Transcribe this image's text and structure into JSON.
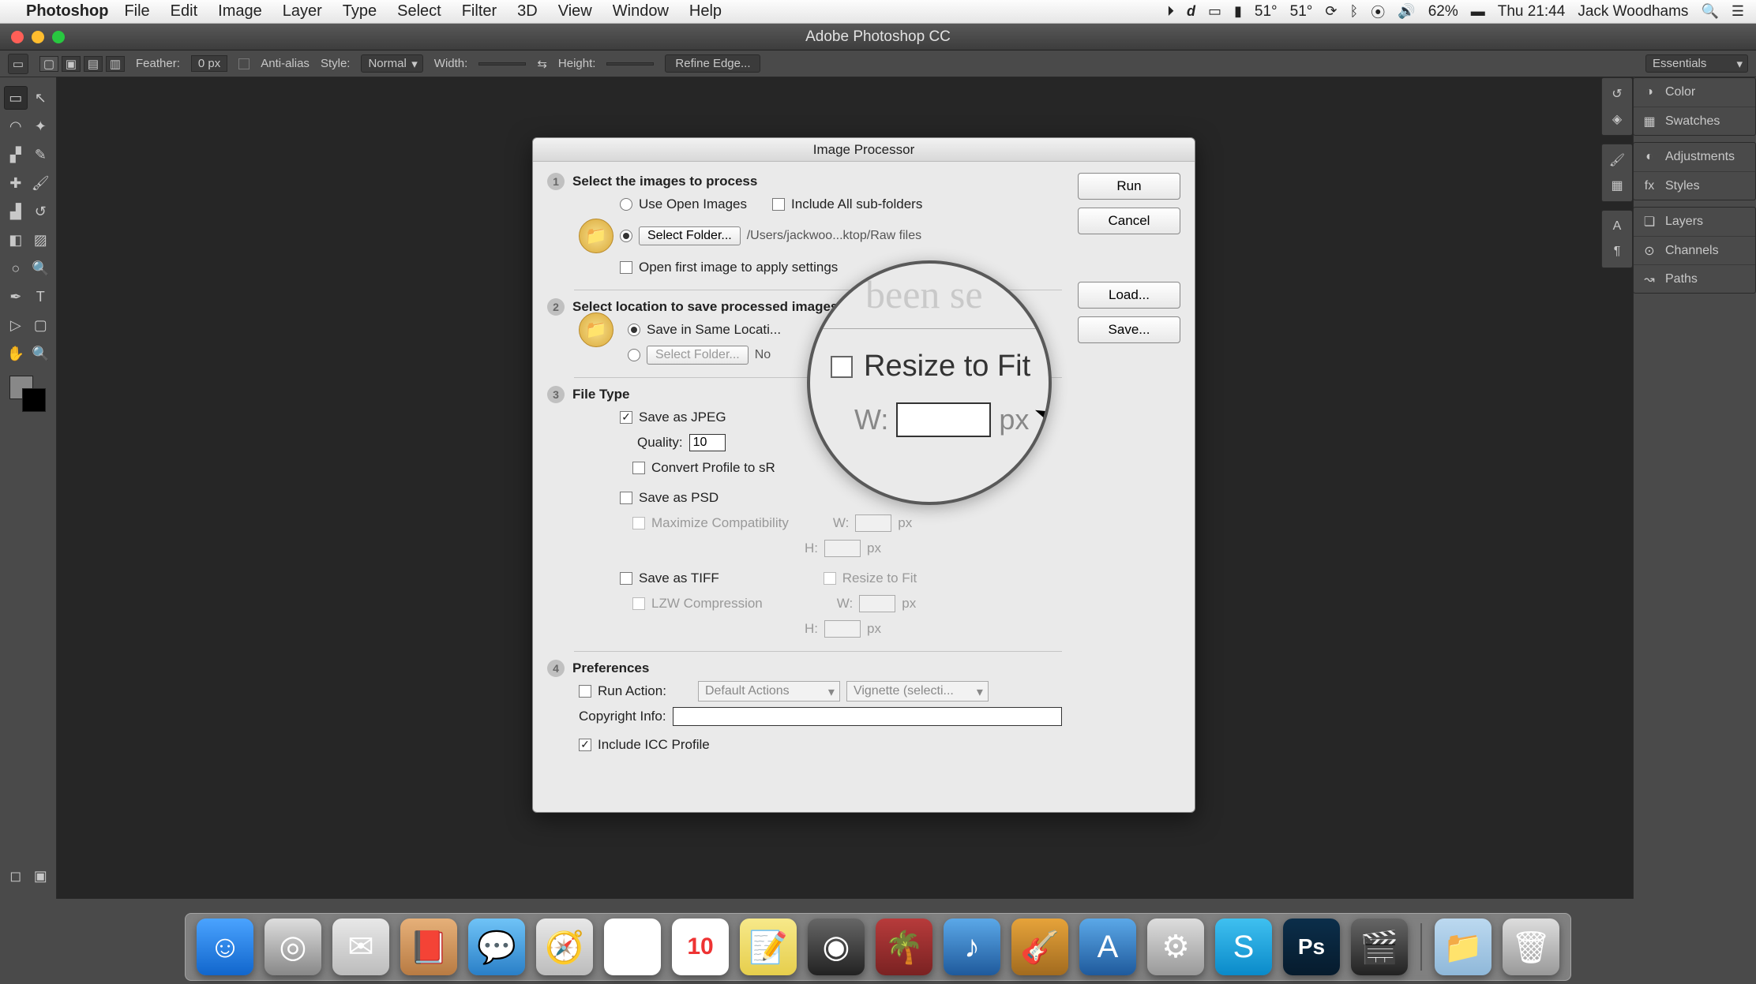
{
  "menubar": {
    "app": "Photoshop",
    "items": [
      "File",
      "Edit",
      "Image",
      "Layer",
      "Type",
      "Select",
      "Filter",
      "3D",
      "View",
      "Window",
      "Help"
    ],
    "right": {
      "temp1": "51°",
      "temp2": "51°",
      "battery": "62%",
      "time": "Thu 21:44",
      "user": "Jack Woodhams"
    }
  },
  "app": {
    "title": "Adobe Photoshop CC"
  },
  "optionsbar": {
    "feather_label": "Feather:",
    "feather_value": "0 px",
    "antialias": "Anti-alias",
    "style_label": "Style:",
    "style_value": "Normal",
    "width_label": "Width:",
    "height_label": "Height:",
    "refine": "Refine Edge...",
    "essentials": "Essentials"
  },
  "right_panels": {
    "group1": [
      {
        "icon": "◑",
        "label": "Color"
      },
      {
        "icon": "▦",
        "label": "Swatches"
      }
    ],
    "group2": [
      {
        "icon": "◐",
        "label": "Adjustments"
      },
      {
        "icon": "fx",
        "label": "Styles"
      }
    ],
    "group3": [
      {
        "icon": "❏",
        "label": "Layers"
      },
      {
        "icon": "⊙",
        "label": "Channels"
      },
      {
        "icon": "↝",
        "label": "Paths"
      }
    ]
  },
  "dialog": {
    "title": "Image Processor",
    "buttons": {
      "run": "Run",
      "cancel": "Cancel",
      "load": "Load...",
      "save": "Save..."
    },
    "s1": {
      "head": "Select the images to process",
      "use_open": "Use Open Images",
      "include_sub": "Include All sub-folders",
      "select_folder": "Select Folder...",
      "path": "/Users/jackwoo...ktop/Raw files",
      "open_first": "Open first image to apply settings"
    },
    "s2": {
      "head": "Select location to save processed images",
      "save_same": "Save in Same Locati...",
      "select_folder": "Select Folder...",
      "no_folder": "No"
    },
    "s3": {
      "head": "File Type",
      "jpeg": "Save as JPEG",
      "quality_label": "Quality:",
      "quality_value": "10",
      "convert_srgb": "Convert Profile to sR",
      "psd": "Save as PSD",
      "max_compat": "Maximize Compatibility",
      "tiff": "Save as TIFF",
      "lzw": "LZW Compression",
      "resize": "Resize to Fit",
      "w": "W:",
      "h": "H:",
      "px": "px"
    },
    "s4": {
      "head": "Preferences",
      "run_action": "Run Action:",
      "action_set": "Default Actions",
      "action": "Vignette (selecti...",
      "copyright": "Copyright Info:",
      "include_icc": "Include ICC Profile"
    }
  },
  "magnifier": {
    "faint": "been se",
    "resize": "Resize to Fit",
    "w": "W:",
    "px": "px"
  },
  "dock": [
    {
      "name": "finder",
      "bg": "linear-gradient(#4aa3ff,#1166cc)",
      "glyph": "☺"
    },
    {
      "name": "launchpad",
      "bg": "linear-gradient(#ddd,#888)",
      "glyph": "◎"
    },
    {
      "name": "mail",
      "bg": "linear-gradient(#e8e8e8,#bcbcbc)",
      "glyph": "✉"
    },
    {
      "name": "contacts",
      "bg": "linear-gradient(#e6b079,#b87b43)",
      "glyph": "📕"
    },
    {
      "name": "messages",
      "bg": "linear-gradient(#6fc3f7,#2a7fc7)",
      "glyph": "💬"
    },
    {
      "name": "safari",
      "bg": "linear-gradient(#e8e8e8,#bcbcbc)",
      "glyph": "🧭"
    },
    {
      "name": "chrome",
      "bg": "#fff",
      "glyph": "◉"
    },
    {
      "name": "calendar",
      "bg": "#fff",
      "glyph": "10"
    },
    {
      "name": "notes",
      "bg": "linear-gradient(#f7e98a,#e6ce4c)",
      "glyph": "📝"
    },
    {
      "name": "photobooth",
      "bg": "linear-gradient(#666,#222)",
      "glyph": "◉"
    },
    {
      "name": "iphoto",
      "bg": "linear-gradient(#b73b3b,#7a2222)",
      "glyph": "🌴"
    },
    {
      "name": "itunes",
      "bg": "linear-gradient(#5ba8e8,#1f5a9c)",
      "glyph": "♪"
    },
    {
      "name": "garageband",
      "bg": "linear-gradient(#e6a33a,#a26b1f)",
      "glyph": "🎸"
    },
    {
      "name": "appstore",
      "bg": "linear-gradient(#5ba8e8,#1f5a9c)",
      "glyph": "A"
    },
    {
      "name": "sysprefs",
      "bg": "linear-gradient(#ddd,#999)",
      "glyph": "⚙"
    },
    {
      "name": "skype",
      "bg": "linear-gradient(#3fc0f0,#0a8ac9)",
      "glyph": "S"
    },
    {
      "name": "photoshop",
      "bg": "linear-gradient(#0b2e4a,#061b2d)",
      "glyph": "Ps"
    },
    {
      "name": "imovie",
      "bg": "linear-gradient(#666,#222)",
      "glyph": "🎬"
    }
  ],
  "dock_extras": [
    {
      "name": "folder",
      "bg": "linear-gradient(#bcd9f0,#8fb8d9)",
      "glyph": "📁"
    },
    {
      "name": "trash",
      "bg": "linear-gradient(#ddd,#999)",
      "glyph": "🗑"
    }
  ]
}
